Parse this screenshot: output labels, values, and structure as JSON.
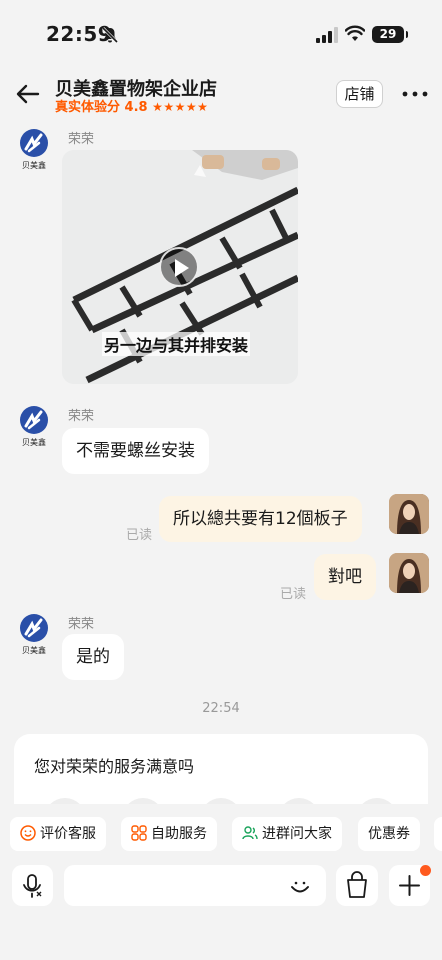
{
  "status_bar": {
    "time": "22:59",
    "battery": "29"
  },
  "header": {
    "title": "贝美鑫置物架企业店",
    "rating_label": "真实体验分 4.8",
    "stars": "★★★★★",
    "store_button": "店铺"
  },
  "agent": {
    "name": "荣荣",
    "avatar_text": "贝美鑫",
    "brand_color": "#2a4fa8"
  },
  "messages": [
    {
      "from": "agent",
      "type": "video",
      "caption": "另一边与其并排安装"
    },
    {
      "from": "agent",
      "type": "text",
      "text": "不需要螺丝安装"
    },
    {
      "from": "me",
      "type": "text",
      "text": "所以總共要有12個板子",
      "status": "已读"
    },
    {
      "from": "me",
      "type": "text",
      "text": "對吧",
      "status": "已读"
    },
    {
      "from": "agent",
      "type": "text",
      "text": "是的"
    }
  ],
  "timestamp": "22:54",
  "survey": {
    "title": "您对荣荣的服务满意吗"
  },
  "quick_actions": [
    {
      "label": "评价客服",
      "icon": "smile-icon"
    },
    {
      "label": "自助服务",
      "icon": "grid-icon"
    },
    {
      "label": "进群问大家",
      "icon": "group-icon"
    },
    {
      "label": "优惠券",
      "icon": ""
    }
  ],
  "colors": {
    "accent": "#ff5a00",
    "my_bubble": "#fdf4e4",
    "background": "#f3f3f3"
  }
}
